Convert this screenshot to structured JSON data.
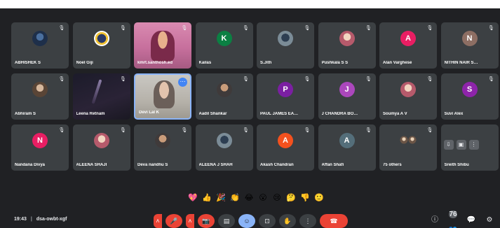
{
  "participants_row1": [
    {
      "name": "ABHISHEK S",
      "avatar": "photo4",
      "initial": ""
    },
    {
      "name": "Noel Giji",
      "avatar": "ring",
      "initial": ""
    },
    {
      "name": "kmrt.santhosh.ed",
      "avatar": "video-pink",
      "initial": ""
    },
    {
      "name": "Kailas",
      "avatar": "letter",
      "initial": "K",
      "color": "#0b8043"
    },
    {
      "name": "S.Jith",
      "avatar": "photo5",
      "initial": ""
    },
    {
      "name": "Pushkala S S",
      "avatar": "photo3",
      "initial": ""
    },
    {
      "name": "Alan Varghese",
      "avatar": "letter",
      "initial": "A",
      "color": "#e91e63"
    },
    {
      "name": "NITHIN NAIR S…",
      "avatar": "letter",
      "initial": "N",
      "color": "#8d6e63"
    }
  ],
  "participants_row2": [
    {
      "name": "Abhiram S",
      "avatar": "photo6",
      "initial": ""
    },
    {
      "name": "Leena Retnam",
      "avatar": "video-dark",
      "initial": ""
    },
    {
      "name": "Devi Lal K",
      "avatar": "video-room",
      "initial": ""
    },
    {
      "name": "Aadil Shankar",
      "avatar": "photo2",
      "initial": ""
    },
    {
      "name": "PAUL JAMES EA…",
      "avatar": "letter",
      "initial": "P",
      "color": "#7b1fa2"
    },
    {
      "name": "J CHANDRA BO…",
      "avatar": "letter",
      "initial": "J",
      "color": "#ab47bc"
    },
    {
      "name": "Soumya A V",
      "avatar": "photo3",
      "initial": ""
    },
    {
      "name": "Suvi Alex",
      "avatar": "letter",
      "initial": "S",
      "color": "#8e24aa"
    }
  ],
  "participants_row3": [
    {
      "name": "Nandana Divya",
      "avatar": "letter",
      "initial": "N",
      "color": "#e91e63"
    },
    {
      "name": "ALEENA SHAJI",
      "avatar": "photo3",
      "initial": ""
    },
    {
      "name": "Deva nandhu S",
      "avatar": "photo2",
      "initial": ""
    },
    {
      "name": "ALEENA J SHAH",
      "avatar": "photo5",
      "initial": ""
    },
    {
      "name": "Akash Chandran",
      "avatar": "letter",
      "initial": "A",
      "color": "#f4511e"
    },
    {
      "name": "Affan Shafi",
      "avatar": "letter",
      "initial": "A",
      "color": "#546e7a"
    },
    {
      "name": "75 others",
      "avatar": "others",
      "initial": ""
    },
    {
      "name": "Sreith Shibu",
      "avatar": "self",
      "initial": ""
    }
  ],
  "reactions": [
    "💖",
    "👍",
    "🎉",
    "👏",
    "😂",
    "😮",
    "😢",
    "🤔",
    "👎",
    "🙂"
  ],
  "meeting": {
    "time": "19:43",
    "code": "dsa-owbt-xgf"
  },
  "controls": {
    "mic_icon": "🎤",
    "camera_icon": "📷",
    "captions_icon": "▤",
    "reactions_icon": "☺",
    "present_icon": "⊡",
    "hand_icon": "✋",
    "more_icon": "⋮",
    "end_icon": "☎"
  },
  "right_controls": {
    "info_icon": "ⓘ",
    "people_icon": "👥",
    "people_count": "76",
    "chat_icon": "💬",
    "activities_icon": "⚙"
  },
  "colors": {
    "background": "#202124",
    "tile": "#3c4043",
    "danger": "#ea4335",
    "accent": "#8ab4f8"
  }
}
